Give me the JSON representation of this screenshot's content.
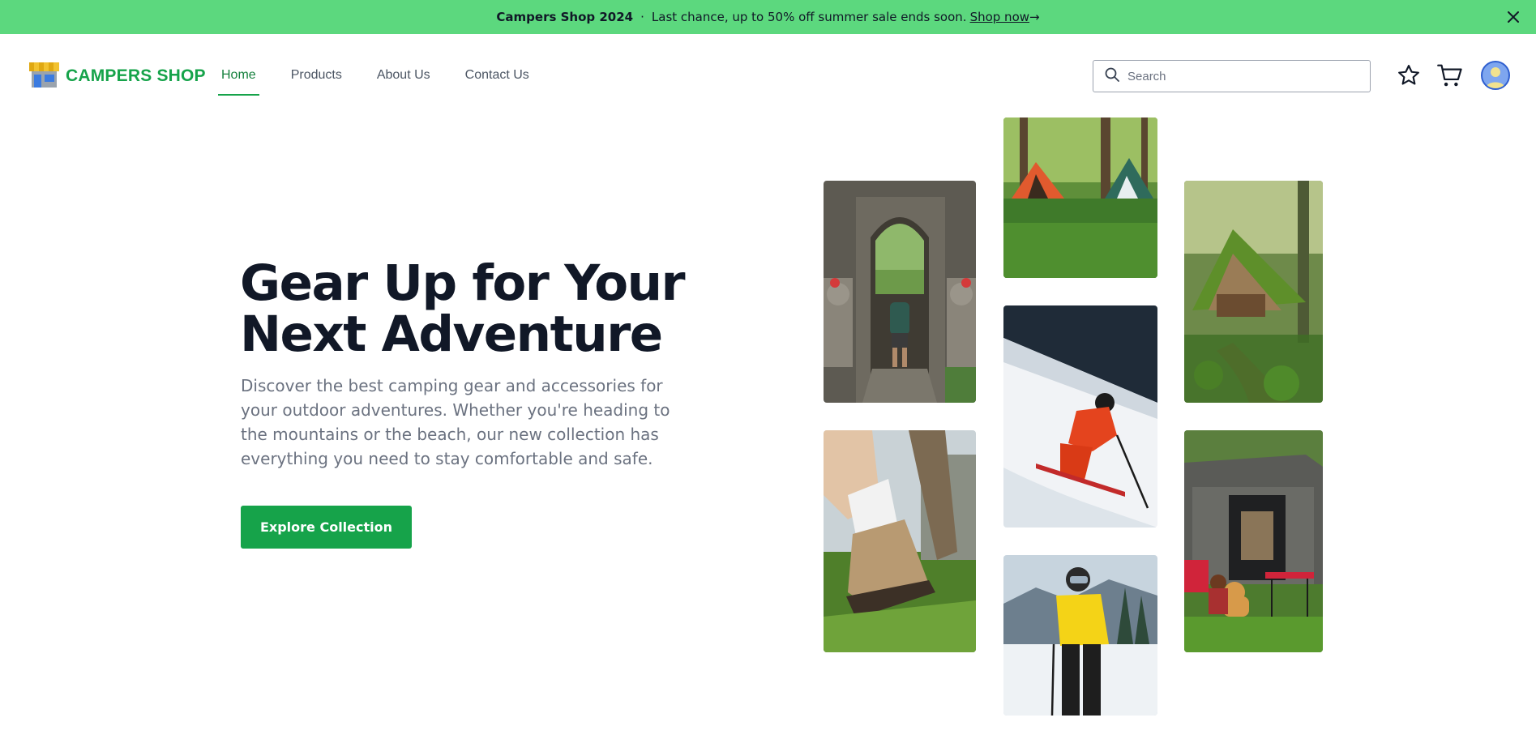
{
  "banner": {
    "brand": "Campers Shop 2024",
    "separator": "·",
    "message": "Last chance, up to 50% off summer sale ends soon.",
    "link_label": "Shop now",
    "link_arrow": "→",
    "close_icon": "close-icon",
    "background": "#5cd87e"
  },
  "header": {
    "logo_text": "CAMPERS SHOP",
    "logo_icon": "store-icon",
    "nav": [
      {
        "label": "Home",
        "active": true
      },
      {
        "label": "Products",
        "active": false
      },
      {
        "label": "About Us",
        "active": false
      },
      {
        "label": "Contact Us",
        "active": false
      }
    ],
    "search": {
      "placeholder": "Search",
      "value": ""
    },
    "icons": [
      "star-icon",
      "cart-icon",
      "avatar"
    ],
    "accent": "#16a34a"
  },
  "hero": {
    "title_line1": "Gear Up for Your",
    "title_line2": "Next Adventure",
    "description": "Discover the best camping gear and accessories for your outdoor adventures. Whether you're heading to the mountains or the beach, our new collection has everything you need to stay comfortable and safe.",
    "cta_label": "Explore Collection",
    "cta_color": "#16a34a"
  },
  "gallery": [
    {
      "name": "photo-temple-hiker"
    },
    {
      "name": "photo-hiking-boots"
    },
    {
      "name": "photo-tents-forest"
    },
    {
      "name": "photo-skier-red"
    },
    {
      "name": "photo-skier-yellow"
    },
    {
      "name": "photo-moss-cabin"
    },
    {
      "name": "photo-camper-van-dog"
    }
  ]
}
